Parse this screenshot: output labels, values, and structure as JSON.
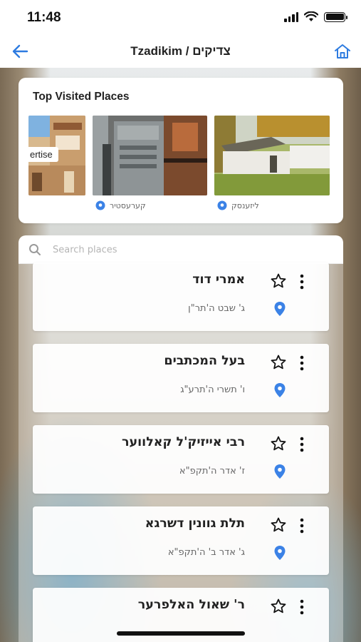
{
  "status_bar": {
    "time": "11:48"
  },
  "nav": {
    "title": "Tzadikim / צדיקים"
  },
  "top_visited": {
    "title": "Top Visited Places",
    "advertise_label": "ertise",
    "places": [
      {
        "caption": ""
      },
      {
        "caption": "קערעסטיר"
      },
      {
        "caption": "ליזענסק"
      }
    ]
  },
  "search": {
    "placeholder": "Search places",
    "value": ""
  },
  "list": [
    {
      "name": "אמרי דוד",
      "date": "ג' שבט ה'תר\"ן"
    },
    {
      "name": "בעל המכתבים",
      "date": "ו' תשרי ה'תרע\"ג"
    },
    {
      "name": "רבי אייזיק'ל קאלווער",
      "date": "ז' אדר ה'תקפ\"א"
    },
    {
      "name": "תלת גוונין דשרגא",
      "date": "ג' אדר ב' ה'תקפ\"א"
    },
    {
      "name": "ר' שאול האלפרער",
      "date": ""
    }
  ],
  "colors": {
    "accent_blue": "#3b82e6",
    "text_dark": "#222222",
    "text_muted": "#666666"
  },
  "icons": [
    "back-arrow-icon",
    "home-icon",
    "search-icon",
    "star-icon",
    "more-vertical-icon",
    "map-pin-icon"
  ]
}
